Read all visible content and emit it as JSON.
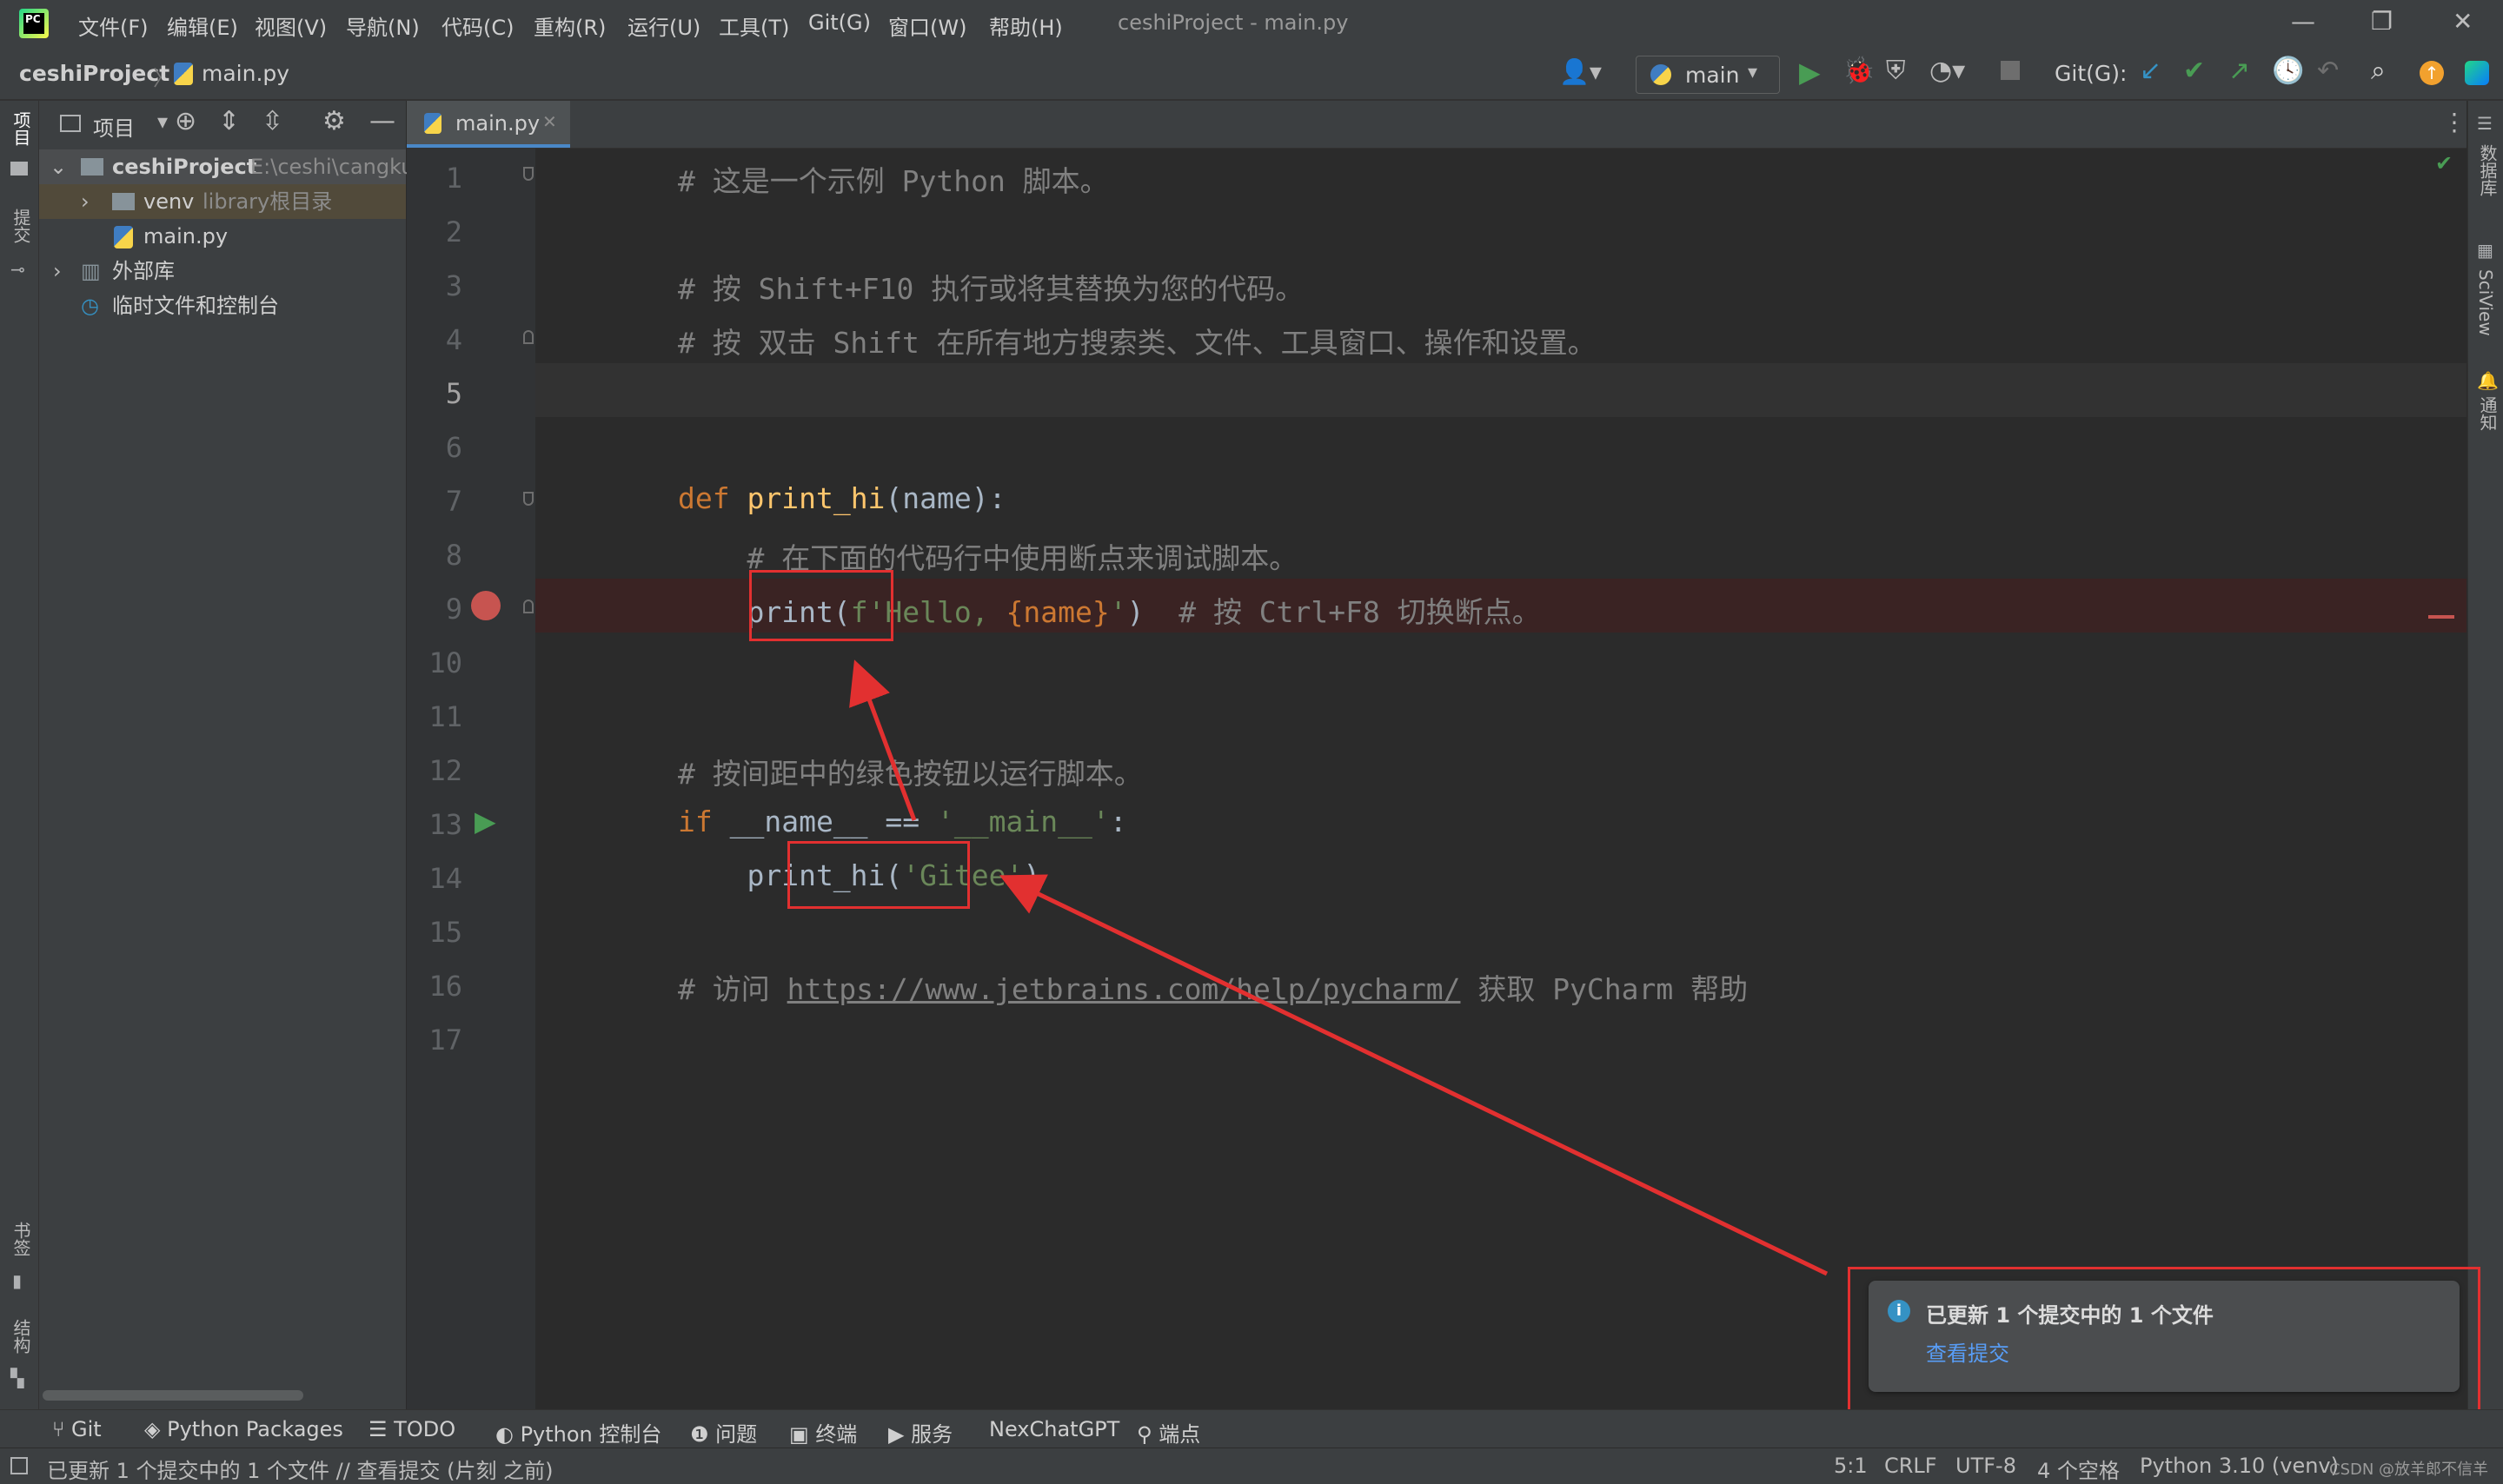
{
  "window": {
    "title": "ceshiProject - main.py",
    "menu": [
      "文件(F)",
      "编辑(E)",
      "视图(V)",
      "导航(N)",
      "代码(C)",
      "重构(R)",
      "运行(U)",
      "工具(T)",
      "Git(G)",
      "窗口(W)",
      "帮助(H)"
    ]
  },
  "nav": {
    "project": "ceshiProject",
    "file": "main.py",
    "run_config": "main",
    "git_label": "Git(G):"
  },
  "project_panel": {
    "title": "项目",
    "items": [
      {
        "label": "ceshiProject",
        "hint": "E:\\ceshi\\cangku"
      },
      {
        "label": "venv",
        "hint": "library根目录"
      },
      {
        "label": "main.py",
        "hint": ""
      },
      {
        "label": "外部库",
        "hint": ""
      },
      {
        "label": "临时文件和控制台",
        "hint": ""
      }
    ]
  },
  "left_stripe": {
    "project": "项目",
    "commit": "提交",
    "bookmarks": "书签",
    "structure": "结构"
  },
  "right_stripe": {
    "database": "数据库",
    "sciview": "SciView",
    "notifications": "通知"
  },
  "editor": {
    "tab_label": "main.py",
    "line_numbers": [
      "1",
      "2",
      "3",
      "4",
      "5",
      "6",
      "7",
      "8",
      "9",
      "10",
      "11",
      "12",
      "13",
      "14",
      "15",
      "16",
      "17"
    ],
    "lines": {
      "l1": "# 这是一个示例 Python 脚本。",
      "l3": "# 按 Shift+F10 执行或将其替换为您的代码。",
      "l4": "# 按 双击 Shift 在所有地方搜索类、文件、工具窗口、操作和设置。",
      "l7_kw": "def ",
      "l7_fn": "print_hi",
      "l7_rest": "(name):",
      "l8": "    # 在下面的代码行中使用断点来调试脚本。",
      "l9_a": "    print(",
      "l9_str": "f'Hello, ",
      "l9_name": "{name}",
      "l9_str2": "'",
      "l9_b": ")  ",
      "l9_comment": "# 按 Ctrl+F8 切换断点。",
      "l12": "# 按间距中的绿色按钮以运行脚本。",
      "l13_kw": "if ",
      "l13_a": "__name__ == ",
      "l13_str": "'__main__'",
      "l13_b": ":",
      "l14_a": "    print_hi(",
      "l14_str": "'Gitee'",
      "l14_b": ")",
      "l16_a": "# 访问 ",
      "l16_link": "https://www.jetbrains.com/help/pycharm/",
      "l16_b": " 获取 PyCharm 帮助"
    }
  },
  "notification": {
    "title": "已更新 1 个提交中的 1 个文件",
    "link": "查看提交"
  },
  "tool_tabs": [
    "Git",
    "Python Packages",
    "TODO",
    "Python 控制台",
    "问题",
    "终端",
    "服务",
    "NexChatGPT",
    "端点"
  ],
  "status": {
    "message": "已更新 1 个提交中的 1 个文件 // 查看提交 (片刻 之前)",
    "position": "5:1",
    "line_sep": "CRLF",
    "encoding": "UTF-8",
    "indent": "4 个空格",
    "interpreter": "Python 3.10 (venv)",
    "watermark": "CSDN @放羊郎不信羊"
  },
  "colors": {
    "accent_red": "#e23030",
    "breakpoint": "#c75450",
    "run_green": "#499c54",
    "link_blue": "#589df6"
  }
}
